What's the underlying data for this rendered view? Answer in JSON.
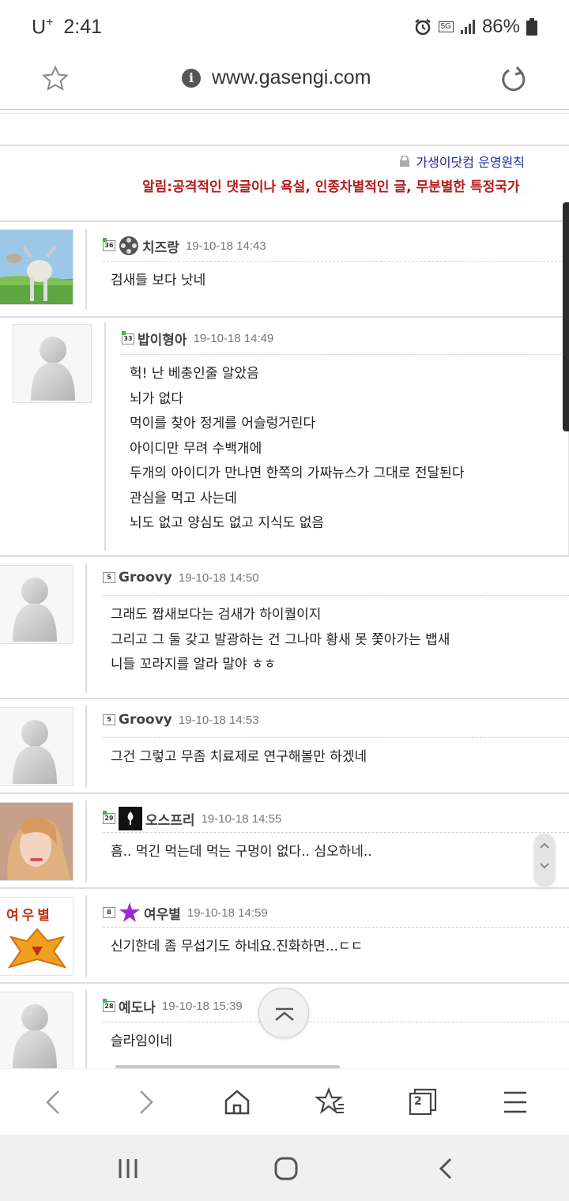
{
  "status_bar": {
    "carrier": "U",
    "carrier_plus": "+",
    "time": "2:41",
    "network": "5G",
    "battery": "86%"
  },
  "browser": {
    "url": "www.gasengi.com"
  },
  "board": {
    "policy_link": "가생이닷컴 운영원칙",
    "notice": "알림:공격적인 댓글이나 욕설, 인종차별적인 글, 무분별한 특정국가"
  },
  "comments": [
    {
      "level": "36",
      "nick": "치즈랑",
      "date": "19-10-18 14:43",
      "lines": [
        "검새들 보다 낫네"
      ]
    },
    {
      "level": "33",
      "nick": "밥이형아",
      "date": "19-10-18 14:49",
      "lines": [
        "헉! 난 베충인줄 알았음",
        "뇌가 없다",
        "먹이를 찾아 정게를 어슬렁거린다",
        "아이디만 무려 수백개에",
        "두개의 아이디가 만나면 한쪽의 가짜뉴스가 그대로 전달된다",
        "관심을 먹고 사는데",
        "뇌도 없고 양심도 없고 지식도 없음"
      ]
    },
    {
      "level": "5",
      "nick": "Groovy",
      "date": "19-10-18 14:50",
      "lines": [
        "그래도 짭새보다는 검새가 하이퀄이지",
        "그리고 그 둘 갖고 발광하는 건 그나마 황새 못 쫓아가는 뱁새",
        "니들 꼬라지를 알라 말야 ㅎㅎ"
      ]
    },
    {
      "level": "5",
      "nick": "Groovy",
      "date": "19-10-18 14:53",
      "lines": [
        "그건 그렇고 무좀 치료제로 연구해볼만 하겠네"
      ]
    },
    {
      "level": "29",
      "nick": "오스프리",
      "date": "19-10-18 14:55",
      "lines": [
        "흠.. 먹긴 먹는데 먹는 구멍이 없다.. 심오하네.."
      ]
    },
    {
      "level": "8",
      "nick": "여우별",
      "date": "19-10-18 14:59",
      "lines": [
        "신기한데 좀 무섭기도 하네요.진화하면...ㄷㄷ"
      ],
      "avatar_text": "여우별"
    },
    {
      "level": "28",
      "nick": "예도나",
      "date": "19-10-18 15:39",
      "lines": [
        "슬라임이네"
      ]
    }
  ],
  "toolbar": {
    "tab_count": "2"
  },
  "icons": [
    "star-icon",
    "info-icon",
    "reload-icon",
    "alarm-icon",
    "signal-icon",
    "battery-icon",
    "lock-icon",
    "back-icon",
    "forward-icon",
    "home-icon",
    "bookmarks-icon",
    "tabs-icon",
    "menu-icon",
    "recent-apps-icon",
    "home-circle-icon",
    "system-back-icon",
    "scroll-top-icon"
  ],
  "colors": {
    "notice": "#b41c1c",
    "policy": "#1a2a9a"
  }
}
